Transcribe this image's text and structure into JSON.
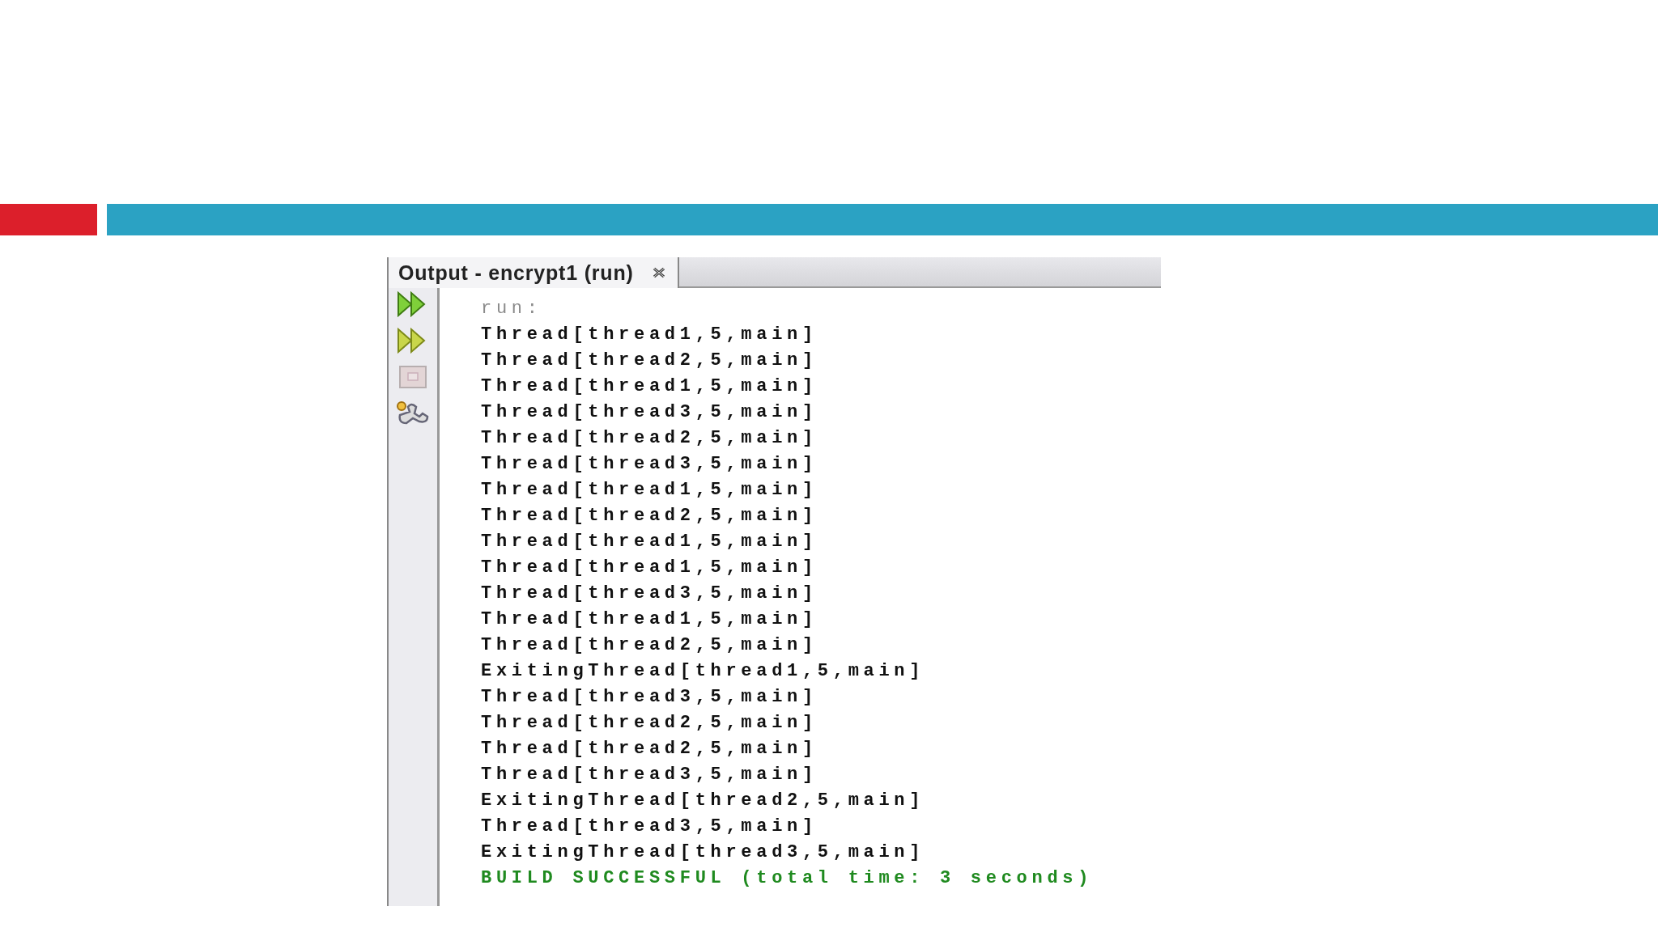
{
  "output_panel": {
    "tab": {
      "label": "Output - encrypt1 (run)",
      "selected": true
    },
    "toolbar": [
      {
        "kind": "rerun",
        "disabled": false
      },
      {
        "kind": "rerun-options",
        "disabled": false
      },
      {
        "kind": "stop",
        "disabled": true
      },
      {
        "kind": "settings",
        "disabled": false
      }
    ],
    "lines": [
      {
        "kind": "echo",
        "text": "run:"
      },
      {
        "kind": "output",
        "text": "Thread[thread1,5,main]"
      },
      {
        "kind": "output",
        "text": "Thread[thread2,5,main]"
      },
      {
        "kind": "output",
        "text": "Thread[thread1,5,main]"
      },
      {
        "kind": "output",
        "text": "Thread[thread3,5,main]"
      },
      {
        "kind": "output",
        "text": "Thread[thread2,5,main]"
      },
      {
        "kind": "output",
        "text": "Thread[thread3,5,main]"
      },
      {
        "kind": "output",
        "text": "Thread[thread1,5,main]"
      },
      {
        "kind": "output",
        "text": "Thread[thread2,5,main]"
      },
      {
        "kind": "output",
        "text": "Thread[thread1,5,main]"
      },
      {
        "kind": "output",
        "text": "Thread[thread1,5,main]"
      },
      {
        "kind": "output",
        "text": "Thread[thread3,5,main]"
      },
      {
        "kind": "output",
        "text": "Thread[thread1,5,main]"
      },
      {
        "kind": "output",
        "text": "Thread[thread2,5,main]"
      },
      {
        "kind": "output",
        "text": "ExitingThread[thread1,5,main]"
      },
      {
        "kind": "output",
        "text": "Thread[thread3,5,main]"
      },
      {
        "kind": "output",
        "text": "Thread[thread2,5,main]"
      },
      {
        "kind": "output",
        "text": "Thread[thread2,5,main]"
      },
      {
        "kind": "output",
        "text": "Thread[thread3,5,main]"
      },
      {
        "kind": "output",
        "text": "ExitingThread[thread2,5,main]"
      },
      {
        "kind": "output",
        "text": "Thread[thread3,5,main]"
      },
      {
        "kind": "output",
        "text": "ExitingThread[thread3,5,main]"
      },
      {
        "kind": "success",
        "text": "BUILD SUCCESSFUL (total time: 3 seconds)"
      }
    ]
  }
}
